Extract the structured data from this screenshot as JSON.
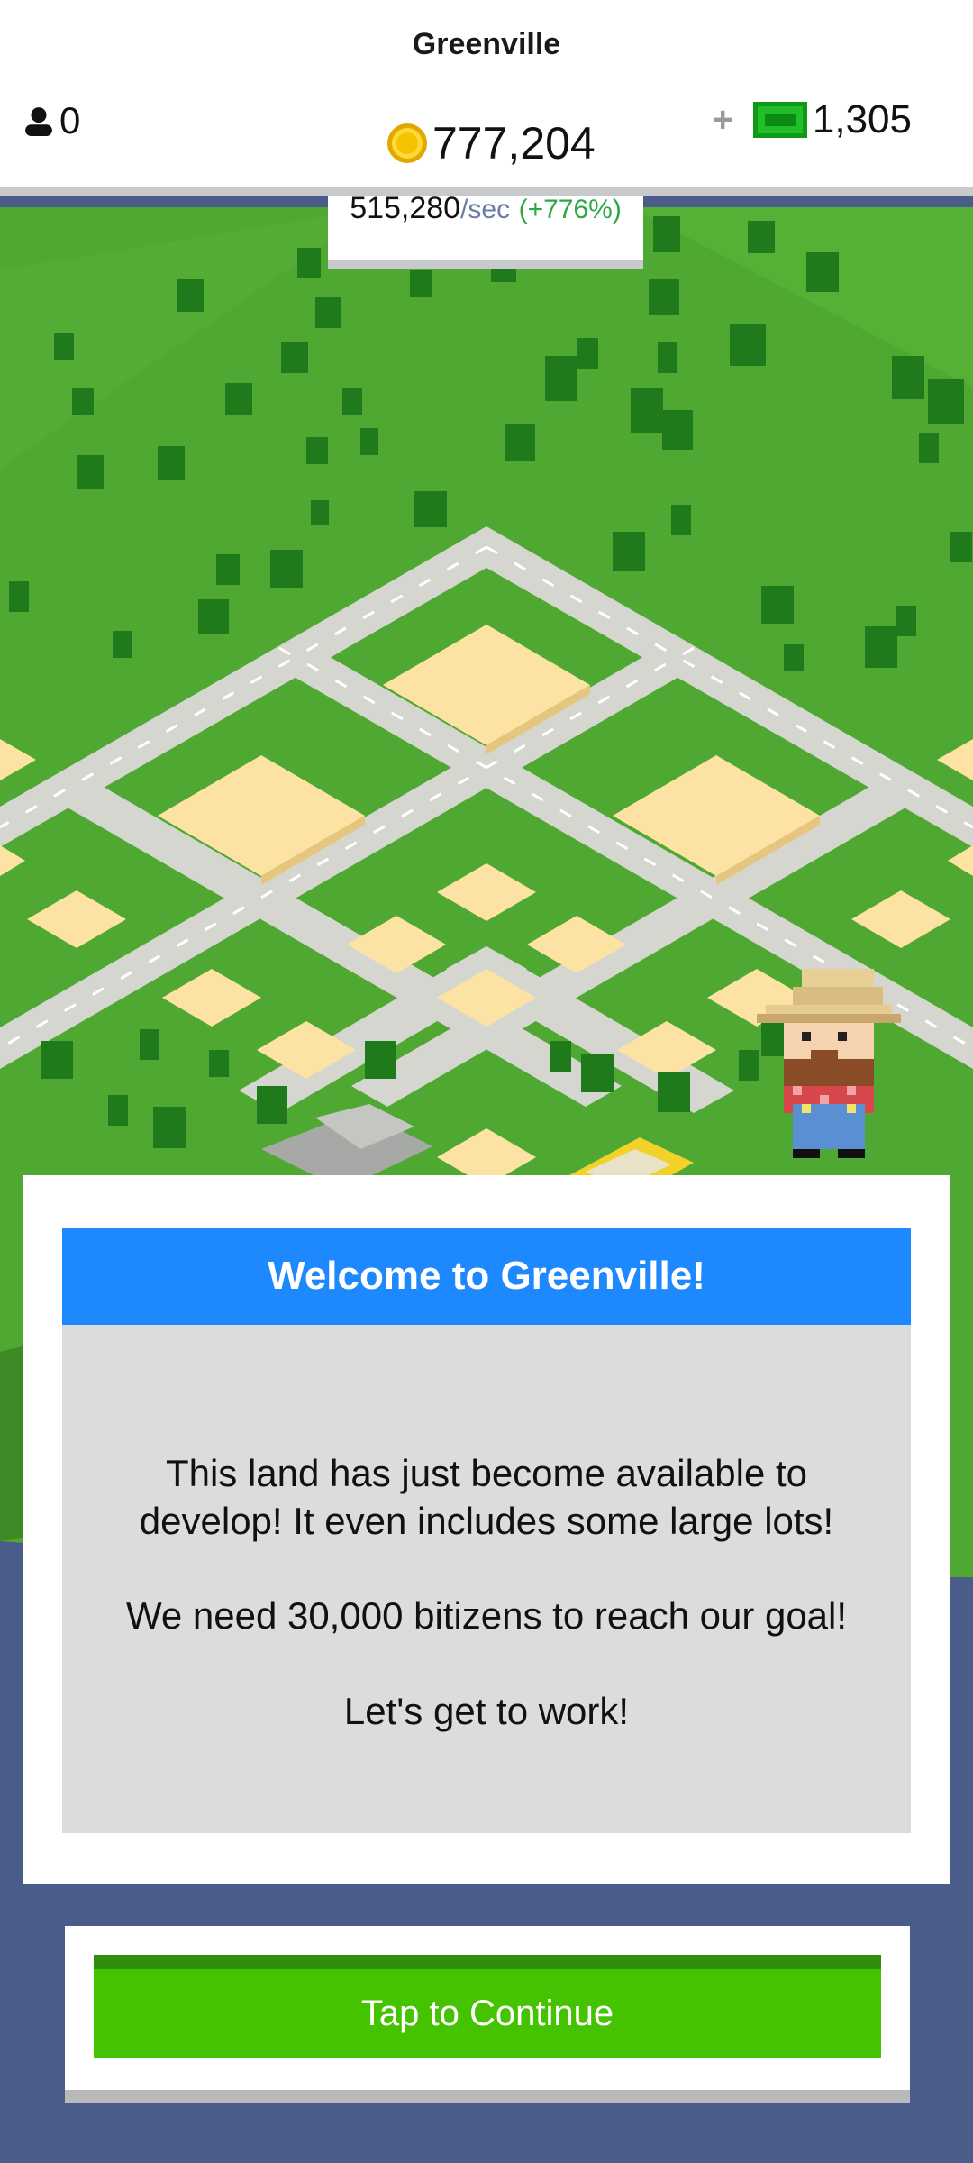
{
  "header": {
    "city_name": "Greenville",
    "population": "0",
    "coins": "777,204",
    "cash_plus": "+",
    "cash": "1,305",
    "rate_value": "515,280",
    "rate_unit": "/sec",
    "rate_change": "(+776%)"
  },
  "icons": {
    "population": "person-icon",
    "coins": "coin-icon",
    "cash": "cash-icon"
  },
  "dialog": {
    "title": "Welcome to Greenville!",
    "line1": "This land has just become available to",
    "line2": "develop! It even includes some large lots!",
    "line3": "We need 30,000 bitizens to reach our goal!",
    "line4": "Let's get to work!"
  },
  "continue_label": "Tap to Continue",
  "colors": {
    "grass": "#4ea832",
    "road": "#d6d6d0",
    "lot": "#fde3a3",
    "water": "#4a5c8a",
    "dialog_header": "#1e88ff",
    "button": "#45c200"
  }
}
